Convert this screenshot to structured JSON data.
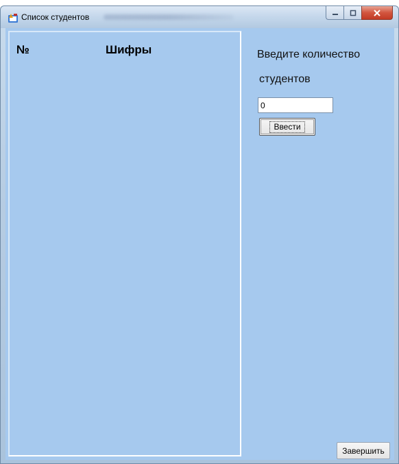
{
  "window": {
    "title": "Список студентов"
  },
  "list": {
    "col_number": "№",
    "col_codes": "Шифры"
  },
  "form": {
    "prompt_line1": "Введите количество",
    "prompt_line2": "студентов",
    "count_value": "0",
    "enter_button": "Ввести",
    "finish_button": "Завершить"
  },
  "icons": {
    "app": "form-app-icon",
    "minimize": "minimize-icon",
    "maximize": "maximize-icon",
    "close": "close-icon"
  }
}
